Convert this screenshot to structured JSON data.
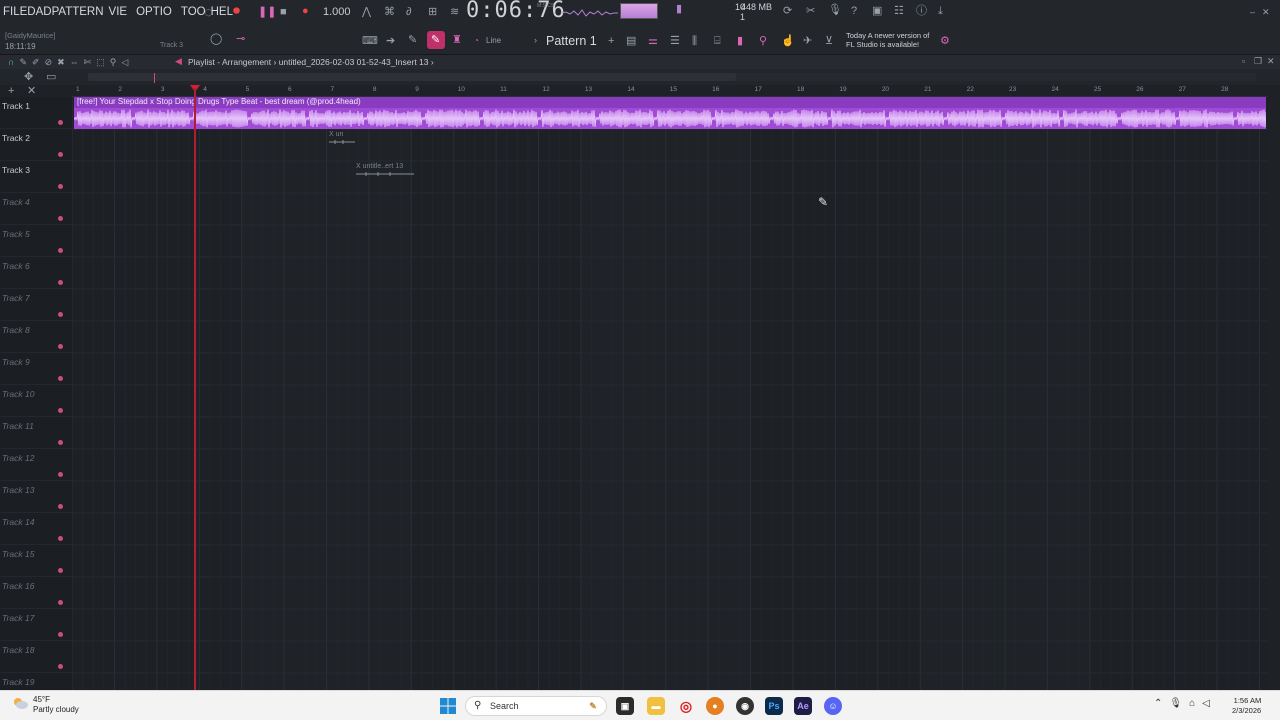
{
  "menu": {
    "items": [
      "FILE",
      "DAD",
      "PATTERN",
      "VIE",
      "OPTIO",
      "TOO",
      "HEL"
    ]
  },
  "toolbar": {
    "hint_user": "[GaidyMaurice]",
    "hint_clock": "18:11:19",
    "hint_track": "Track 3",
    "tempo": "1.000",
    "time": "0:06:76",
    "time_unit": "M:S:CS",
    "cpu_top": "10",
    "cpu_bottom": "1",
    "memory": "448 MB",
    "line_mode": "Line",
    "pattern": "Pattern 1",
    "news_line1": "Today  A newer version of",
    "news_line2": "FL Studio is available!",
    "accent": "#c0306a"
  },
  "playlist": {
    "title": "Playlist - Arrangement › untitled_2026-02-03 01-52-43_Insert 13 ›",
    "ruler": [
      "1",
      "2",
      "3",
      "4",
      "5",
      "6",
      "7",
      "8",
      "9",
      "10",
      "11",
      "12",
      "13",
      "14",
      "15",
      "16",
      "17",
      "18",
      "19",
      "20",
      "21",
      "22",
      "23",
      "24",
      "25",
      "26",
      "27",
      "28"
    ],
    "tracks": [
      {
        "name": "Track 1",
        "active": true
      },
      {
        "name": "Track 2",
        "active": true
      },
      {
        "name": "Track 3",
        "active": true
      },
      {
        "name": "Track 4",
        "active": false
      },
      {
        "name": "Track 5",
        "active": false
      },
      {
        "name": "Track 6",
        "active": false
      },
      {
        "name": "Track 7",
        "active": false
      },
      {
        "name": "Track 8",
        "active": false
      },
      {
        "name": "Track 9",
        "active": false
      },
      {
        "name": "Track 10",
        "active": false
      },
      {
        "name": "Track 11",
        "active": false
      },
      {
        "name": "Track 12",
        "active": false
      },
      {
        "name": "Track 13",
        "active": false
      },
      {
        "name": "Track 14",
        "active": false
      },
      {
        "name": "Track 15",
        "active": false
      },
      {
        "name": "Track 16",
        "active": false
      },
      {
        "name": "Track 17",
        "active": false
      },
      {
        "name": "Track 18",
        "active": false
      },
      {
        "name": "Track 19",
        "active": false
      }
    ],
    "main_clip": "[free!] Your Stepdad x Stop Doing Drugs Type Beat - best dream (@prod.4head)",
    "clip_track2": "X un",
    "clip_track3": "X untitle..ert 13",
    "clip_color": "#a04bd6"
  },
  "taskbar": {
    "temperature": "45°F",
    "weather": "Partly cloudy",
    "search_placeholder": "Search",
    "time": "1:56 AM",
    "date": "2/3/2026",
    "apps": [
      "Ps",
      "Ae"
    ]
  }
}
